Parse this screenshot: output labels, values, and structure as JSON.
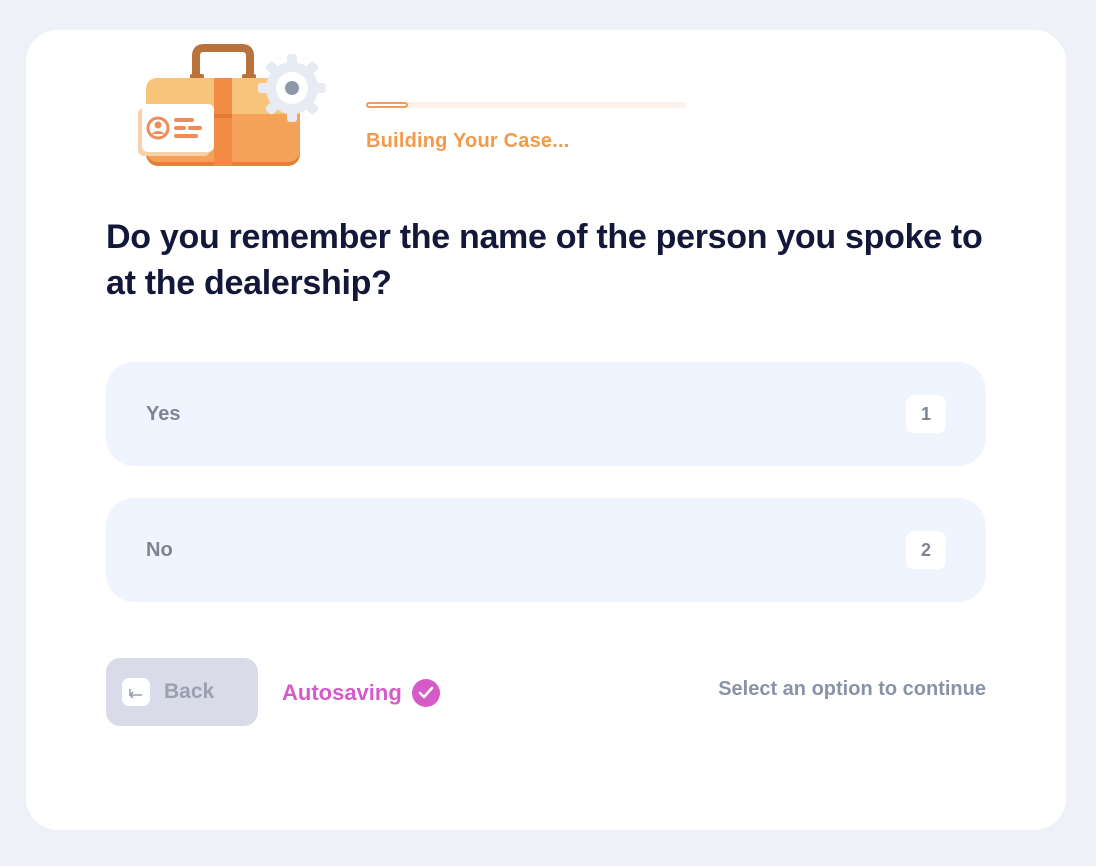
{
  "header": {
    "status_text": "Building Your Case...",
    "progress_fraction": 0.13
  },
  "question": {
    "text": "Do you remember the name of the person you spoke to at the dealership?"
  },
  "options": [
    {
      "label": "Yes",
      "key": "1"
    },
    {
      "label": "No",
      "key": "2"
    }
  ],
  "footer": {
    "back_label": "Back",
    "back_icon": "return-arrow-icon",
    "autosave_label": "Autosaving",
    "autosave_icon": "check-circle-icon",
    "hint": "Select an option to continue"
  },
  "colors": {
    "accent_orange": "#f39a4a",
    "accent_pink": "#d65ac8",
    "heading": "#13183b",
    "option_bg": "#f0f4fe"
  }
}
